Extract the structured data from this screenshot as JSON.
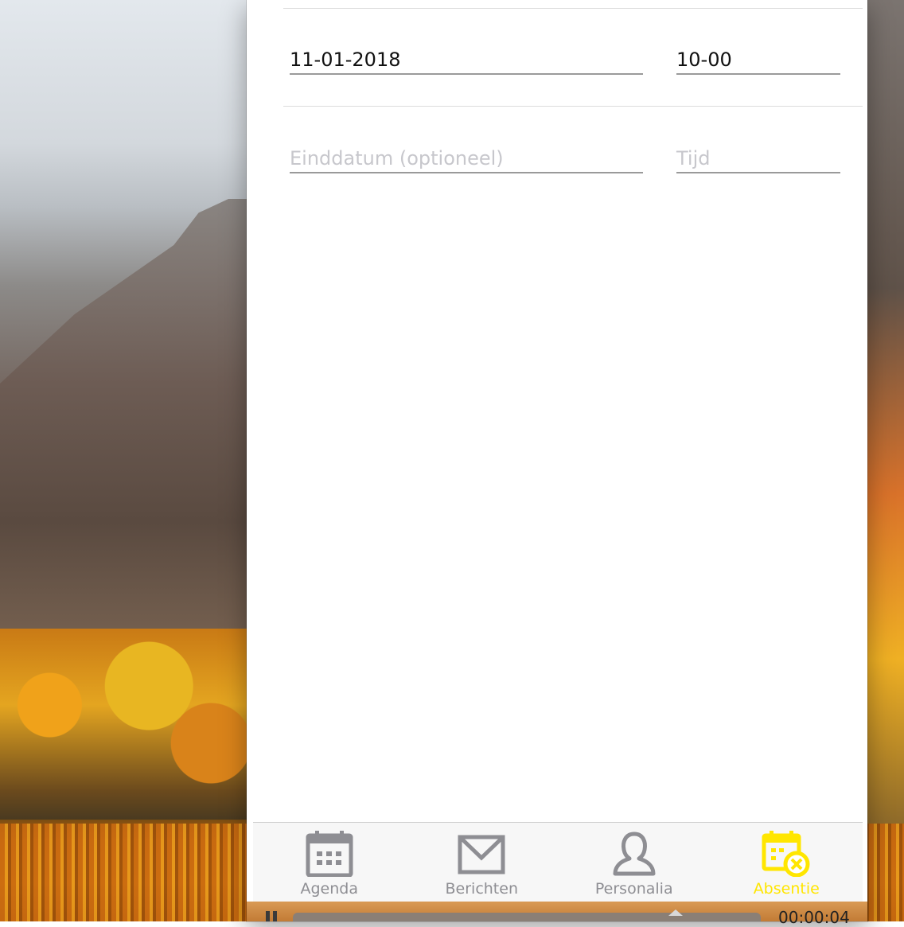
{
  "form": {
    "start_date_value": "11-01-2018",
    "start_time_value": "10-00",
    "end_date_placeholder": "Einddatum (optioneel)",
    "end_time_placeholder": "Tijd"
  },
  "tabbar": {
    "tabs": [
      {
        "label": "Agenda",
        "icon": "calendar-icon",
        "active": false
      },
      {
        "label": "Berichten",
        "icon": "envelope-icon",
        "active": false
      },
      {
        "label": "Personalia",
        "icon": "person-icon",
        "active": false
      },
      {
        "label": "Absentie",
        "icon": "calendar-cancel-icon",
        "active": true
      }
    ]
  },
  "media": {
    "timecode": "00:00:04"
  },
  "colors": {
    "accent": "#ffe600",
    "inactive_tab": "#8e8e93",
    "field_underline": "#9a9a9a",
    "placeholder": "#c7c7cc"
  }
}
